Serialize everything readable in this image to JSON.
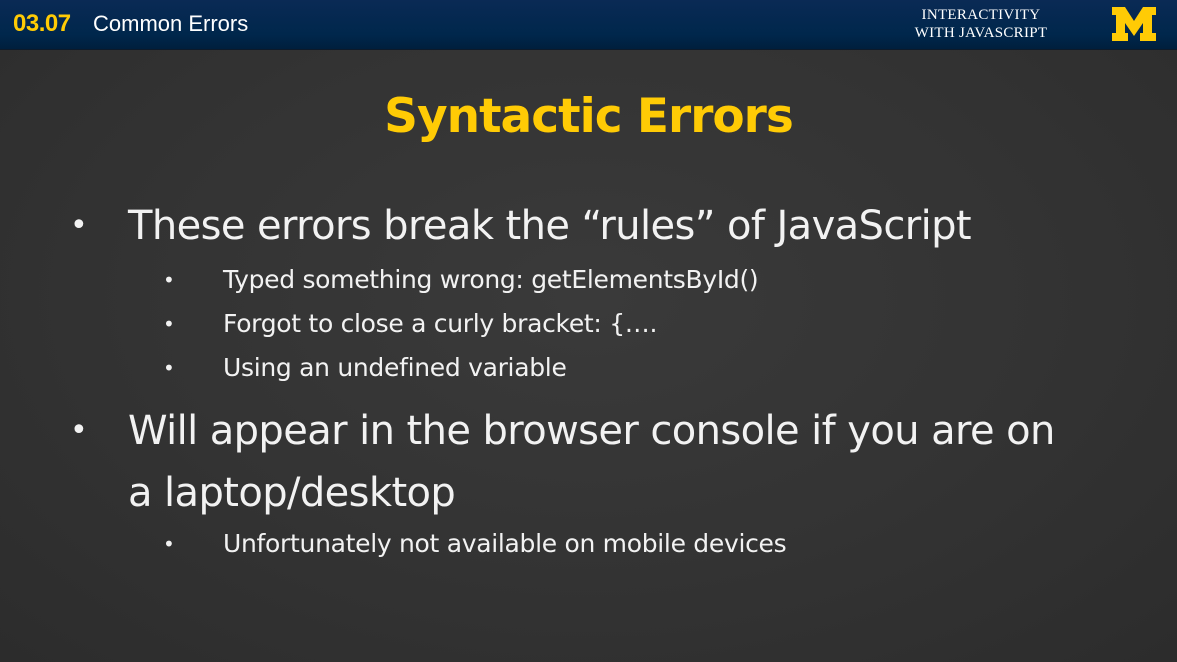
{
  "header": {
    "lesson_number": "03.07",
    "lesson_title": "Common Errors",
    "course_title_line1": "INTERACTIVITY",
    "course_title_line2": "WITH JAVASCRIPT",
    "logo_icon": "university-of-michigan-block-m-logo",
    "background_color": "#00274c",
    "accent_color": "#ffcb05"
  },
  "slide": {
    "title": "Syntactic Errors",
    "background_color": "#333333",
    "text_color": "#f2f2f2",
    "bullets": [
      {
        "text": "These errors break the “rules” of JavaScript",
        "sub": [
          "Typed something wrong: getElementsById()",
          "Forgot to close a curly bracket: {….",
          "Using an undefined variable"
        ]
      },
      {
        "text": "Will appear in the browser console if you are on a laptop/desktop",
        "sub": [
          "Unfortunately not available on mobile devices"
        ]
      }
    ]
  }
}
